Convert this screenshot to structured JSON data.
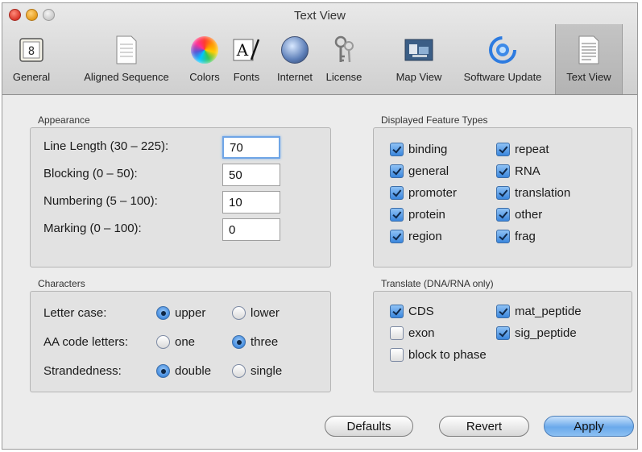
{
  "window": {
    "title": "Text View"
  },
  "toolbar": {
    "items": [
      {
        "label": "General",
        "icon": "general-icon"
      },
      {
        "label": "Aligned Sequence",
        "icon": "document-icon"
      },
      {
        "label": "Colors",
        "icon": "color-wheel-icon"
      },
      {
        "label": "Fonts",
        "icon": "fonts-icon"
      },
      {
        "label": "Internet",
        "icon": "globe-icon"
      },
      {
        "label": "License",
        "icon": "keys-icon"
      },
      {
        "label": "Map View",
        "icon": "map-view-icon"
      },
      {
        "label": "Software Update",
        "icon": "software-update-icon"
      },
      {
        "label": "Text View",
        "icon": "text-view-icon",
        "selected": true
      }
    ]
  },
  "appearance": {
    "title": "Appearance",
    "rows": [
      {
        "label": "Line Length (30 – 225):",
        "value": "70"
      },
      {
        "label": "Blocking (0 – 50):",
        "value": "50"
      },
      {
        "label": "Numbering (5 – 100):",
        "value": "10"
      },
      {
        "label": "Marking (0 – 100):",
        "value": "0"
      }
    ]
  },
  "feature_types": {
    "title": "Displayed Feature Types",
    "items": [
      {
        "label": "binding",
        "checked": true
      },
      {
        "label": "repeat",
        "checked": true
      },
      {
        "label": "general",
        "checked": true
      },
      {
        "label": "RNA",
        "checked": true
      },
      {
        "label": "promoter",
        "checked": true
      },
      {
        "label": "translation",
        "checked": true
      },
      {
        "label": "protein",
        "checked": true
      },
      {
        "label": "other",
        "checked": true
      },
      {
        "label": "region",
        "checked": true
      },
      {
        "label": "frag",
        "checked": true
      }
    ]
  },
  "characters": {
    "title": "Characters",
    "rows": [
      {
        "label": "Letter case:",
        "options": [
          "upper",
          "lower"
        ],
        "selected": "upper"
      },
      {
        "label": "AA code letters:",
        "options": [
          "one",
          "three"
        ],
        "selected": "three"
      },
      {
        "label": "Strandedness:",
        "options": [
          "double",
          "single"
        ],
        "selected": "double"
      }
    ]
  },
  "translate": {
    "title": "Translate (DNA/RNA only)",
    "items": [
      {
        "label": "CDS",
        "checked": true
      },
      {
        "label": "mat_peptide",
        "checked": true
      },
      {
        "label": "exon",
        "checked": false
      },
      {
        "label": "sig_peptide",
        "checked": true
      },
      {
        "label": "block to phase",
        "checked": false
      }
    ]
  },
  "buttons": {
    "defaults": "Defaults",
    "revert": "Revert",
    "apply": "Apply"
  }
}
